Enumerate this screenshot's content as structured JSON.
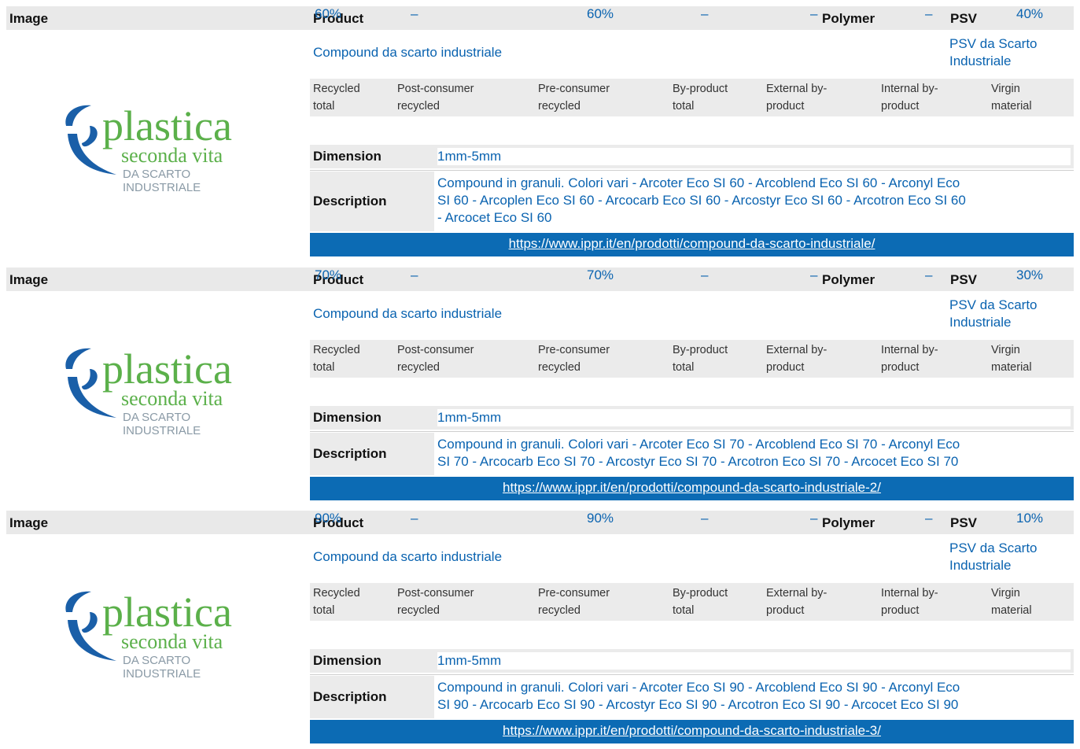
{
  "header": {
    "image": "Image",
    "product": "Product",
    "polymer": "Polymer",
    "psv": "PSV"
  },
  "stat_headers": [
    [
      "Recycled",
      "total"
    ],
    [
      "Post-consumer",
      "recycled"
    ],
    [
      "Pre-consumer",
      "recycled"
    ],
    [
      "By-product",
      "total"
    ],
    [
      "External by-",
      "product"
    ],
    [
      "Internal by-",
      "product"
    ],
    [
      "Virgin",
      "material"
    ]
  ],
  "labels": {
    "dimension": "Dimension",
    "description": "Description"
  },
  "logo": {
    "line1": "plastica",
    "line2": "seconda vita",
    "line3": "DA SCARTO",
    "line4": "INDUSTRIALE",
    "colors": {
      "green": "#5bb04a",
      "blue": "#1a5fa8",
      "gray": "#8a9aa6"
    }
  },
  "products": [
    {
      "name": "Compound da scarto industriale",
      "psv": [
        "PSV da Scarto",
        "Industriale"
      ],
      "values": [
        "60%",
        "–",
        "60%",
        "–",
        "–",
        "–",
        "40%"
      ],
      "dimension": "1mm-5mm",
      "description": [
        "Compound in granuli. Colori vari - Arcoter Eco SI 60 - Arcoblend Eco SI 60 - Arconyl Eco",
        "SI 60 - Arcoplen Eco SI 60 - Arcocarb Eco SI 60 - Arcostyr Eco SI 60 - Arcotron Eco SI 60",
        "- Arcocet Eco SI 60"
      ],
      "url": "https://www.ippr.it/en/prodotti/compound-da-scarto-industriale/"
    },
    {
      "name": "Compound da scarto industriale",
      "psv": [
        "PSV da Scarto",
        "Industriale"
      ],
      "values": [
        "70%",
        "–",
        "70%",
        "–",
        "–",
        "–",
        "30%"
      ],
      "dimension": "1mm-5mm",
      "description": [
        "Compound in granuli. Colori vari - Arcoter Eco SI 70 - Arcoblend Eco SI 70 - Arconyl Eco",
        "SI 70 - Arcocarb Eco SI 70 - Arcostyr Eco SI 70 - Arcotron Eco SI 70 - Arcocet Eco SI 70"
      ],
      "url": "https://www.ippr.it/en/prodotti/compound-da-scarto-industriale-2/"
    },
    {
      "name": "Compound da scarto industriale",
      "psv": [
        "PSV da Scarto",
        "Industriale"
      ],
      "values": [
        "90%",
        "–",
        "90%",
        "–",
        "–",
        "–",
        "10%"
      ],
      "dimension": "1mm-5mm",
      "description": [
        "Compound in granuli. Colori vari - Arcoter Eco SI 90 - Arcoblend Eco SI 90 - Arconyl Eco",
        "SI 90 - Arcocarb Eco SI 90 - Arcostyr Eco SI 90 - Arcotron Eco SI 90 - Arcocet Eco SI 90"
      ],
      "url": "https://www.ippr.it/en/prodotti/compound-da-scarto-industriale-3/"
    }
  ]
}
